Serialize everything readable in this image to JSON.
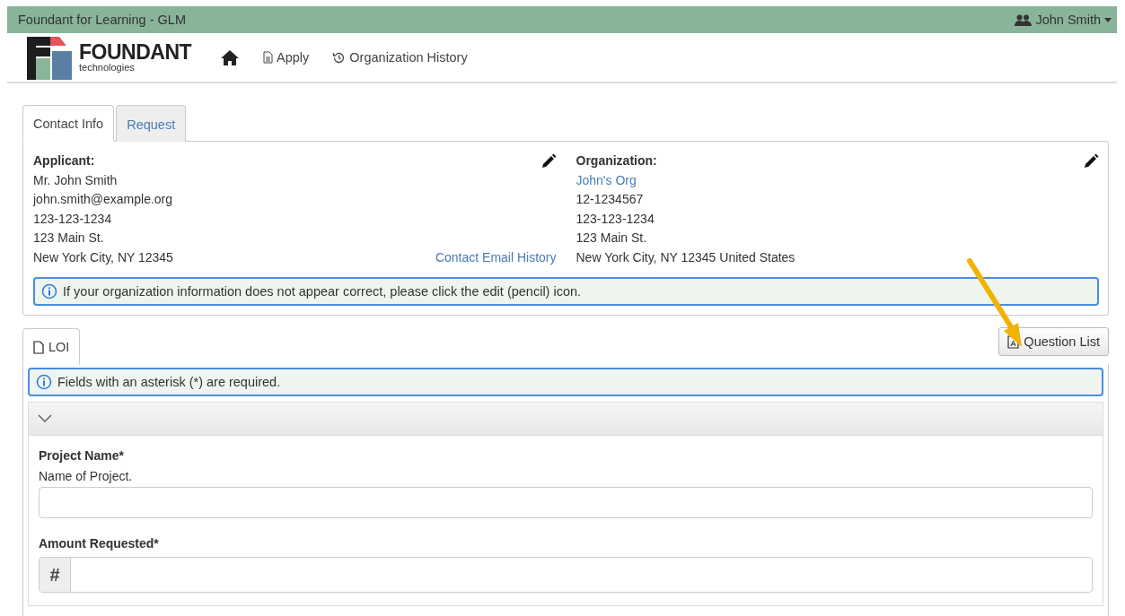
{
  "top_bar": {
    "title": "Foundant for Learning - GLM",
    "user": "John Smith"
  },
  "nav": {
    "logo": {
      "name": "FOUNDANT",
      "tagline": "technologies"
    },
    "links": [
      {
        "kind": "home"
      },
      {
        "kind": "doc",
        "label": "Apply"
      },
      {
        "kind": "history",
        "label": "Organization History"
      }
    ]
  },
  "contact_tabs": [
    {
      "label": "Contact Info",
      "selected": true
    },
    {
      "label": "Request",
      "selected": false
    }
  ],
  "applicant": {
    "heading": "Applicant:",
    "lines": [
      "Mr. John Smith",
      "john.smith@example.org",
      "123-123-1234",
      "123 Main St.",
      "New York City, NY 12345"
    ],
    "link": "Contact Email History"
  },
  "organization": {
    "heading": "Organization:",
    "name": "John's Org",
    "lines": [
      "12-1234567",
      "123-123-1234",
      "123 Main St.",
      "New York City, NY 12345 United States"
    ]
  },
  "org_notice": "If your organization information does not appear correct, please click the edit (pencil) icon.",
  "form_tabs": [
    {
      "label": "LOI",
      "selected": true
    }
  ],
  "question_list_button": "Question List",
  "required_notice": "Fields with an asterisk (*) are required.",
  "section": {
    "expanded": true,
    "fields": [
      {
        "kind": "text",
        "label": "Project Name*",
        "help": "Name of Project."
      },
      {
        "kind": "number",
        "label": "Amount Requested*",
        "addon": "#"
      }
    ]
  }
}
